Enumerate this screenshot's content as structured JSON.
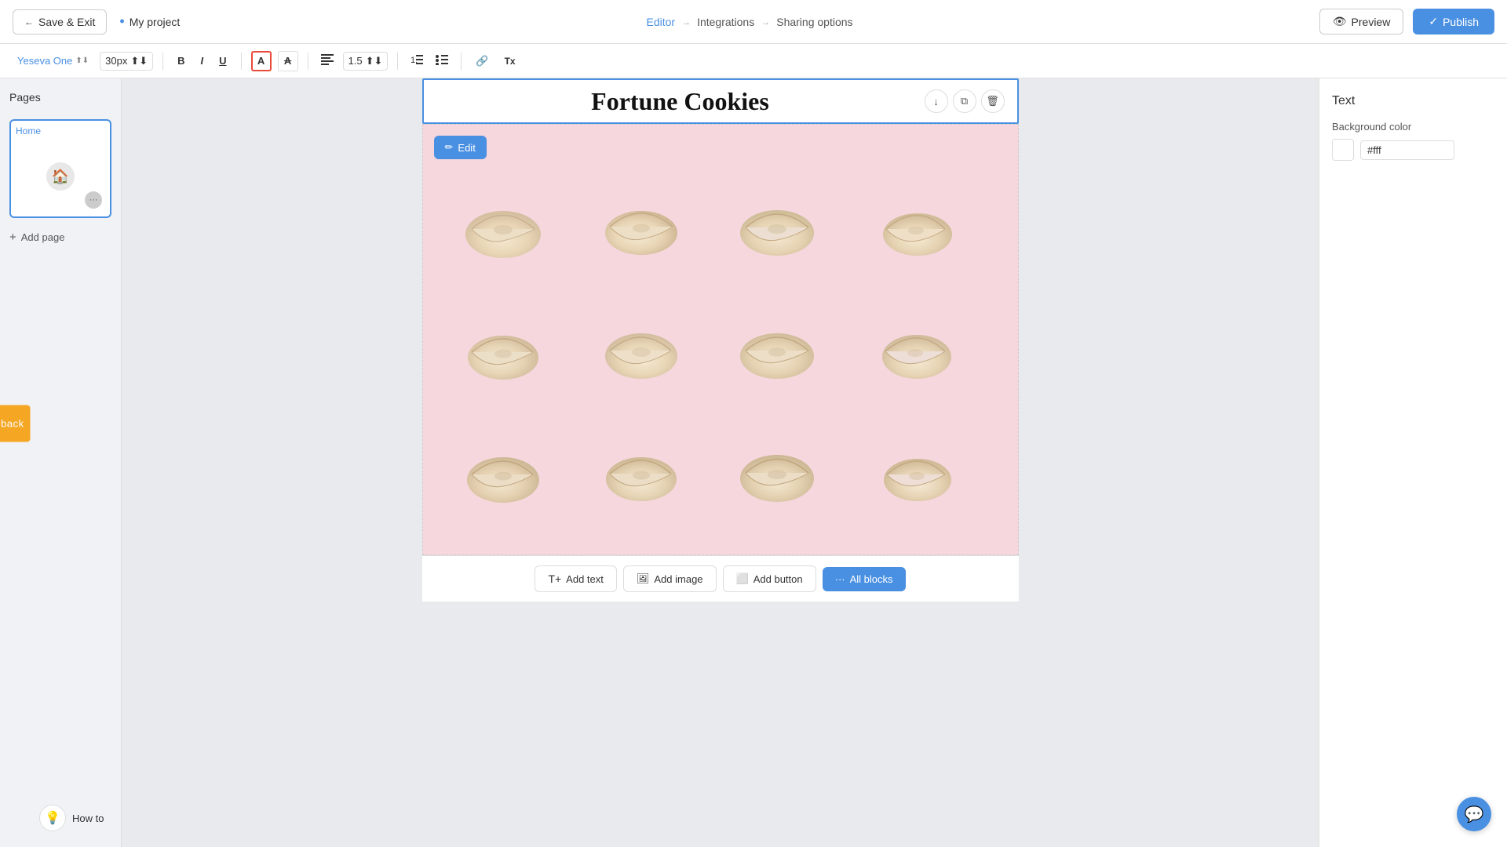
{
  "topNav": {
    "saveExitLabel": "Save & Exit",
    "projectName": "My project",
    "editorLabel": "Editor",
    "integrationsLabel": "Integrations",
    "sharingLabel": "Sharing options",
    "previewLabel": "Preview",
    "publishLabel": "Publish"
  },
  "toolbar": {
    "fontFamily": "Yeseva One",
    "fontSize": "30px",
    "boldLabel": "B",
    "italicLabel": "I",
    "underlineLabel": "U",
    "colorALabel": "A",
    "colorA2Label": "A",
    "alignLeft": "≡",
    "lineHeight": "1.5",
    "listOrdered": "≔",
    "listUnordered": "≡",
    "linkLabel": "🔗",
    "moreLabel": "Tx"
  },
  "sidebar": {
    "title": "Pages",
    "homeLabel": "Home",
    "addPageLabel": "Add page"
  },
  "canvas": {
    "titleText": "Fortune Cookies",
    "editButtonLabel": "Edit"
  },
  "addBlocksBar": {
    "addTextLabel": "Add text",
    "addImageLabel": "Add image",
    "addButtonLabel": "Add button",
    "allBlocksLabel": "All blocks"
  },
  "rightPanel": {
    "title": "Text",
    "backgroundColorLabel": "Background color",
    "backgroundColorValue": "#fff"
  },
  "feedbackTab": {
    "label": "Feedback"
  },
  "howTo": {
    "label": "How to"
  }
}
